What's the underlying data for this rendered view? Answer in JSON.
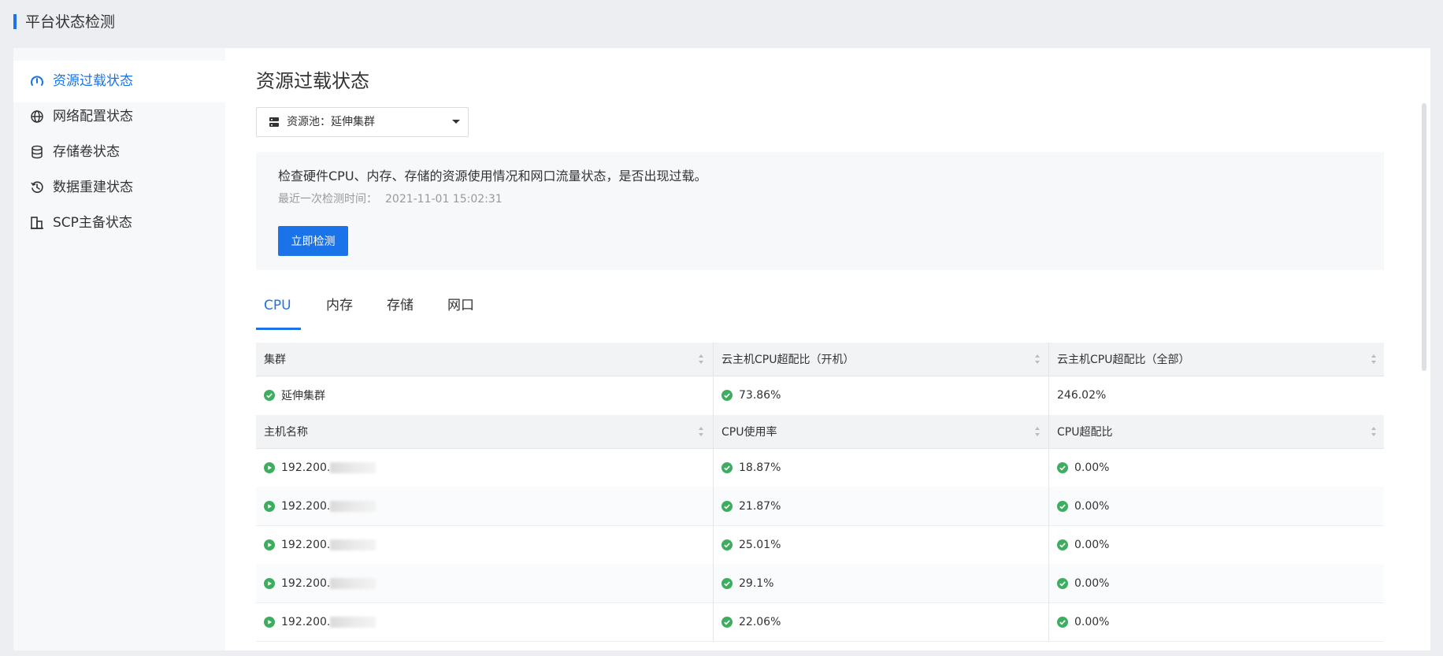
{
  "header": {
    "title": "平台状态检测"
  },
  "sidebar": {
    "items": [
      {
        "label": "资源过载状态",
        "icon": "gauge-icon",
        "active": true
      },
      {
        "label": "网络配置状态",
        "icon": "globe-icon",
        "active": false
      },
      {
        "label": "存储卷状态",
        "icon": "database-icon",
        "active": false
      },
      {
        "label": "数据重建状态",
        "icon": "history-icon",
        "active": false
      },
      {
        "label": "SCP主备状态",
        "icon": "building-icon",
        "active": false
      }
    ]
  },
  "main": {
    "title": "资源过载状态",
    "pool_select": {
      "label": "资源池：延伸集群",
      "icon": "server-icon"
    },
    "info": {
      "description": "检查硬件CPU、内存、存储的资源使用情况和网口流量状态，是否出现过载。",
      "last_check_label": "最近一次检测时间：",
      "last_check_time": "2021-11-01 15:02:31",
      "detect_button": "立即检测"
    },
    "tabs": [
      {
        "label": "CPU",
        "active": true
      },
      {
        "label": "内存",
        "active": false
      },
      {
        "label": "存储",
        "active": false
      },
      {
        "label": "网口",
        "active": false
      }
    ],
    "cluster_table": {
      "headers": [
        "集群",
        "云主机CPU超配比（开机）",
        "云主机CPU超配比（全部）"
      ],
      "rows": [
        {
          "name": "延伸集群",
          "vm_cpu_overcommit_on": "73.86%",
          "vm_cpu_overcommit_all": "246.02%"
        }
      ]
    },
    "host_table": {
      "headers": [
        "主机名称",
        "CPU使用率",
        "CPU超配比"
      ],
      "rows": [
        {
          "host": "192.200.",
          "cpu_usage": "18.87%",
          "cpu_overcommit": "0.00%"
        },
        {
          "host": "192.200.",
          "cpu_usage": "21.87%",
          "cpu_overcommit": "0.00%"
        },
        {
          "host": "192.200.",
          "cpu_usage": "25.01%",
          "cpu_overcommit": "0.00%"
        },
        {
          "host": "192.200.",
          "cpu_usage": "29.1%",
          "cpu_overcommit": "0.00%"
        },
        {
          "host": "192.200.",
          "cpu_usage": "22.06%",
          "cpu_overcommit": "0.00%"
        }
      ]
    }
  },
  "colors": {
    "accent": "#1a73e8",
    "success": "#3dae5f",
    "page_bg": "#eceef2"
  }
}
